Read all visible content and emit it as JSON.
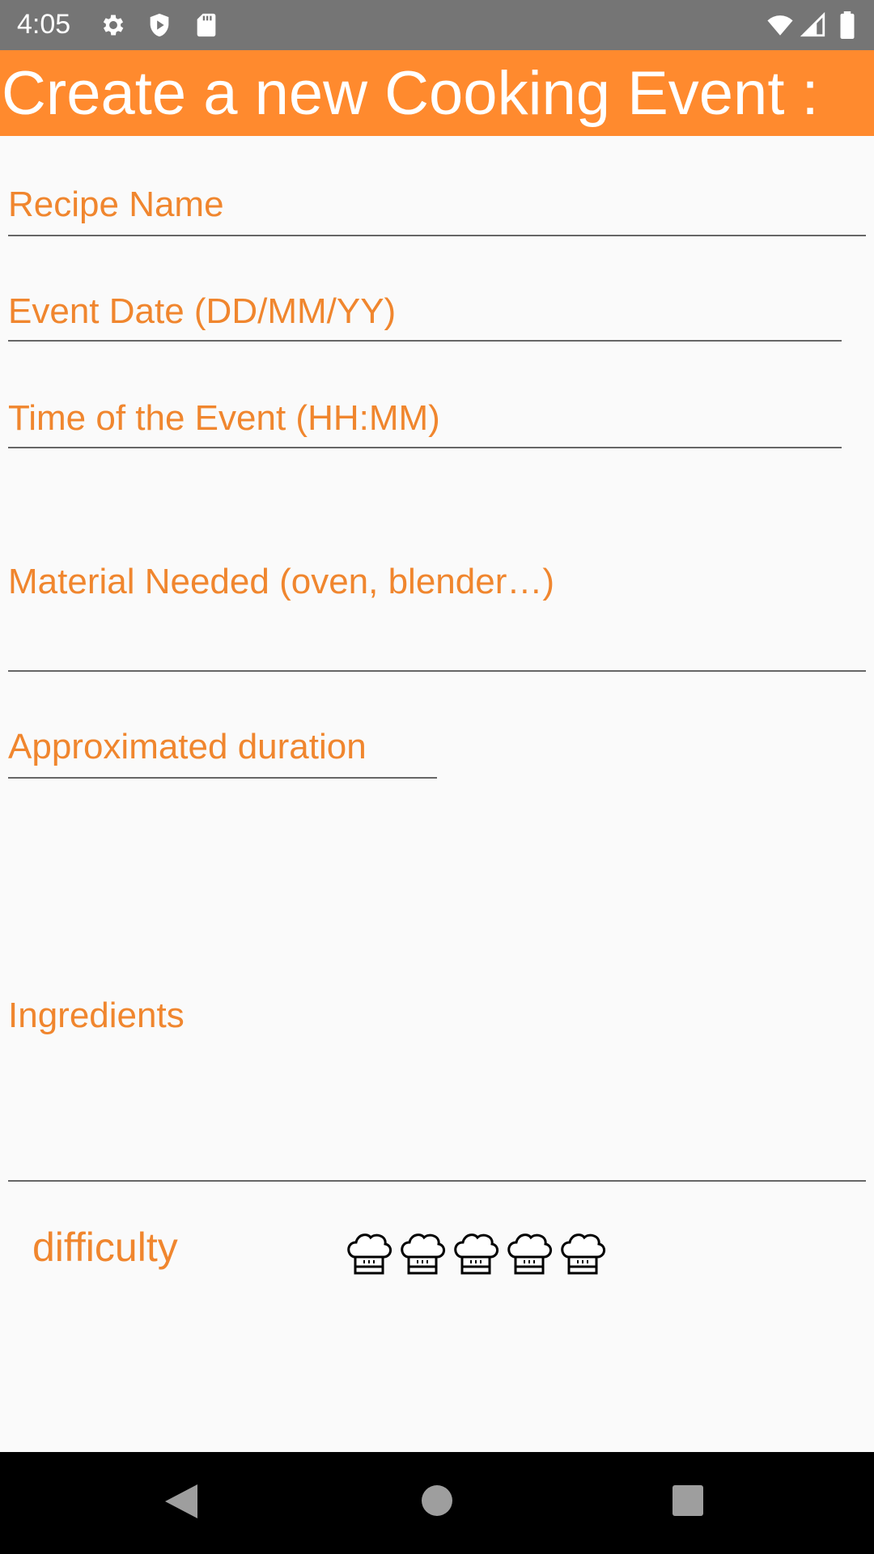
{
  "status_bar": {
    "time": "4:05",
    "icons_left": [
      "gear-icon",
      "shield-icon",
      "sd-card-icon"
    ],
    "icons_right": [
      "wifi-icon",
      "cell-signal-icon",
      "battery-icon"
    ]
  },
  "header": {
    "title": "Create a new Cooking Event :",
    "background_color": "#ff8a2e",
    "text_color": "#ffffff"
  },
  "form": {
    "recipe_name": {
      "placeholder": "Recipe Name",
      "value": ""
    },
    "event_date": {
      "placeholder": "Event Date (DD/MM/YY)",
      "value": ""
    },
    "event_time": {
      "placeholder": "Time of the Event (HH:MM)",
      "value": ""
    },
    "material": {
      "placeholder": "Material Needed (oven, blender…)",
      "value": ""
    },
    "duration": {
      "placeholder": "Approximated duration",
      "value": ""
    },
    "ingredients": {
      "placeholder": "Ingredients",
      "value": ""
    },
    "label_color": "#f0862e"
  },
  "difficulty": {
    "label": "difficulty",
    "max": 5,
    "selected": 0,
    "icon": "chef-hat-icon"
  },
  "nav_bar": {
    "buttons": [
      "back-icon",
      "home-icon",
      "recents-icon"
    ]
  }
}
